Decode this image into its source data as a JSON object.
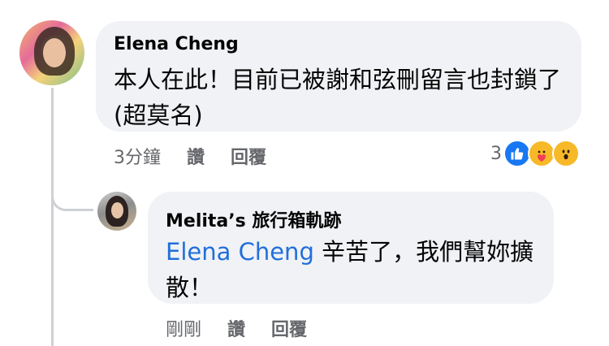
{
  "comment": {
    "author": "Elena Cheng",
    "text": "本人在此！目前已被謝和弦刪留言也封鎖了(超莫名)",
    "time": "3分鐘",
    "like_label": "讚",
    "reply_label": "回覆",
    "reaction_count": "3",
    "reactions": [
      "like-icon",
      "care-icon",
      "wow-icon"
    ]
  },
  "reply": {
    "author": "Melita’s 旅行箱軌跡",
    "mention": "Elena Cheng",
    "text": " 辛苦了，我們幫妳擴散！",
    "time": "剛剛",
    "like_label": "讚",
    "reply_label": "回覆"
  },
  "colors": {
    "bubble": "#f0f2f5",
    "mention": "#216fdb",
    "meta": "#65676b"
  }
}
